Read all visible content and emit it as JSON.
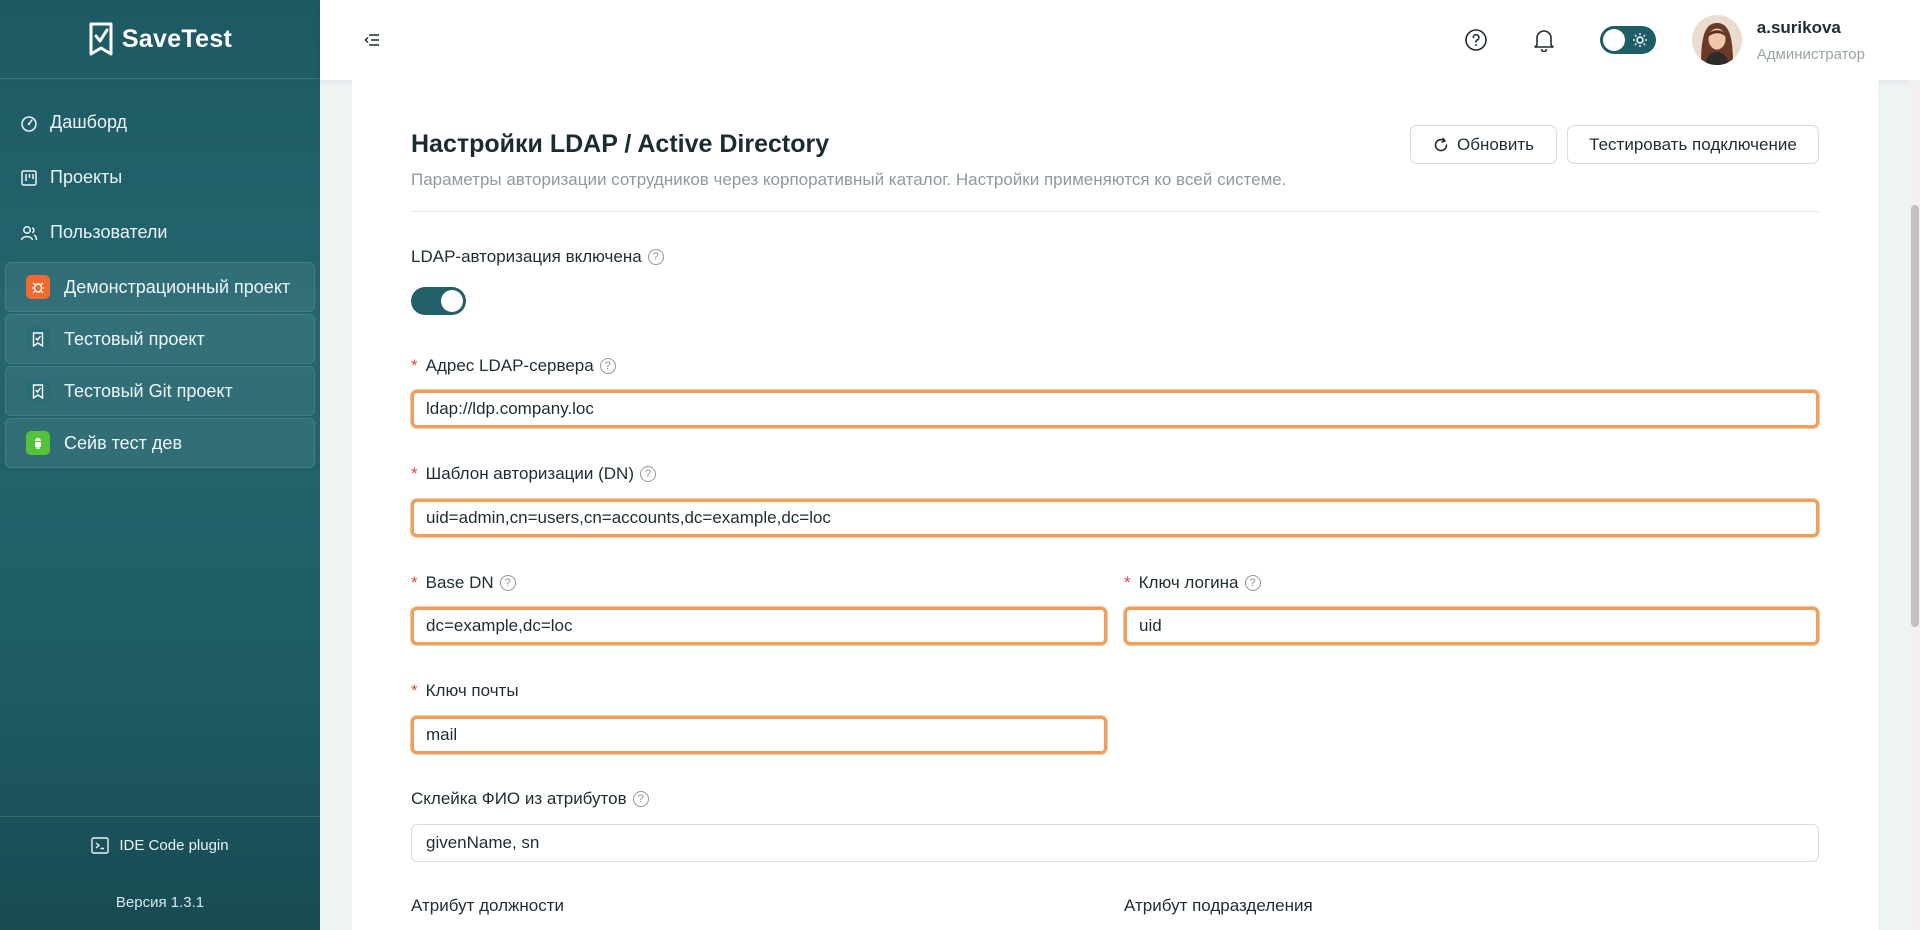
{
  "app": {
    "name": "SaveTest"
  },
  "sidebar": {
    "nav": [
      {
        "label": "Дашборд",
        "icon": "dashboard-icon"
      },
      {
        "label": "Проекты",
        "icon": "projects-icon"
      },
      {
        "label": "Пользователи",
        "icon": "users-icon"
      }
    ],
    "projects": [
      {
        "label": "Демонстрационный проект",
        "icon": "bug-icon",
        "color": "#f26a2e"
      },
      {
        "label": "Тестовый проект",
        "icon": "checklist-icon",
        "color": "#2b6d76"
      },
      {
        "label": "Тестовый Git проект",
        "icon": "checklist-icon",
        "color": "#2b6d76"
      },
      {
        "label": "Сейв тест дев",
        "icon": "android-icon",
        "color": "#56c23a"
      }
    ],
    "plugin_label": "IDE Code plugin",
    "version": "Версия 1.3.1"
  },
  "header": {
    "user_name": "a.surikova",
    "user_role": "Администратор"
  },
  "page": {
    "title": "Настройки LDAP / Active Directory",
    "subtitle": "Параметры авторизации сотрудников через корпоративный каталог. Настройки применяются ко всей системе.",
    "refresh_label": "Обновить",
    "test_label": "Тестировать подключение"
  },
  "form": {
    "ldap_enabled_label": "LDAP-авторизация включена",
    "ldap_enabled": true,
    "server_label": "Адрес LDAP-сервера",
    "server_value": "ldap://ldp.company.loc",
    "dn_label": "Шаблон авторизации (DN)",
    "dn_value": "uid=admin,cn=users,cn=accounts,dc=example,dc=loc",
    "base_dn_label": "Base DN",
    "base_dn_value": "dc=example,dc=loc",
    "login_key_label": "Ключ логина",
    "login_key_value": "uid",
    "mail_key_label": "Ключ почты",
    "mail_key_value": "mail",
    "fio_label": "Склейка ФИО из атрибутов",
    "fio_value": "givenName, sn",
    "position_label": "Атрибут должности",
    "department_label": "Атрибут подразделения"
  },
  "colors": {
    "accent": "#1f5e67",
    "required": "#e0473a",
    "highlight": "#ee9f5c"
  }
}
